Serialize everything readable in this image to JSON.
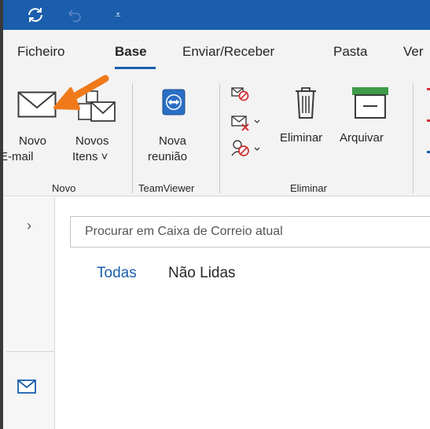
{
  "quick_access": {
    "sync_icon": "sync-icon",
    "undo_icon": "undo-icon",
    "customize_glyph": "⩡"
  },
  "menu": {
    "tabs": [
      {
        "label": "Ficheiro"
      },
      {
        "label": "Base",
        "active": true
      },
      {
        "label": "Enviar/Receber"
      },
      {
        "label": "Pasta"
      },
      {
        "label": "Ver"
      }
    ]
  },
  "ribbon": {
    "new_email": {
      "line1": "Novo",
      "line2": "E-mail"
    },
    "new_items": {
      "line1": "Novos",
      "line2": "Itens ˅"
    },
    "new_meeting": {
      "line1": "Nova",
      "line2": "reunião"
    },
    "delete": {
      "label": "Eliminar"
    },
    "archive": {
      "label": "Arquivar"
    },
    "groups": {
      "novo": "Novo",
      "teamviewer": "TeamViewer",
      "eliminar": "Eliminar"
    }
  },
  "search": {
    "placeholder": "Procurar em Caixa de Correio atual"
  },
  "filters": {
    "all": "Todas",
    "unread": "Não Lidas"
  },
  "rail": {
    "expand_glyph": "›"
  },
  "colors": {
    "accent": "#1a5eac",
    "annotation_arrow": "#f07a1a",
    "archive_green": "#3d9a48",
    "delete_red": "#d13438"
  }
}
